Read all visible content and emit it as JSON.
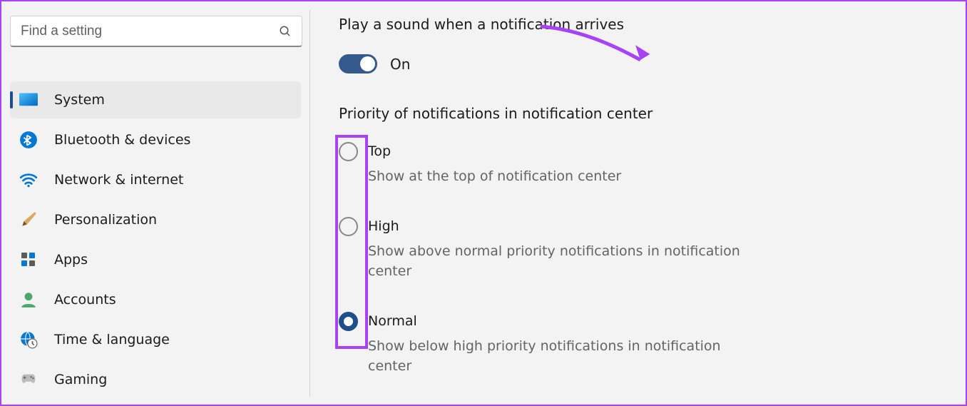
{
  "search": {
    "placeholder": "Find a setting"
  },
  "sidebar": {
    "items": [
      {
        "label": "System"
      },
      {
        "label": "Bluetooth & devices"
      },
      {
        "label": "Network & internet"
      },
      {
        "label": "Personalization"
      },
      {
        "label": "Apps"
      },
      {
        "label": "Accounts"
      },
      {
        "label": "Time & language"
      },
      {
        "label": "Gaming"
      }
    ]
  },
  "main": {
    "sound_setting_title": "Play a sound when a notification arrives",
    "toggle_state": "On",
    "priority_heading": "Priority of notifications in notification center",
    "options": [
      {
        "title": "Top",
        "desc": "Show at the top of notification center"
      },
      {
        "title": "High",
        "desc": "Show above normal priority notifications in notification center"
      },
      {
        "title": "Normal",
        "desc": "Show below high priority notifications in notification center"
      }
    ]
  }
}
